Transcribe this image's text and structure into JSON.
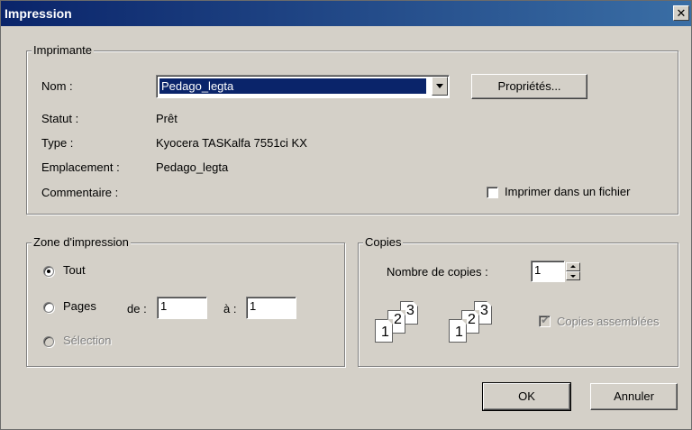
{
  "window": {
    "title": "Impression",
    "close_glyph": "✕"
  },
  "printer": {
    "group_label": "Imprimante",
    "name_label": "Nom :",
    "name_value": "Pedago_legta",
    "properties_button": "Propriétés...",
    "status_label": "Statut :",
    "status_value": "Prêt",
    "type_label": "Type :",
    "type_value": "Kyocera TASKalfa 7551ci KX",
    "location_label": "Emplacement :",
    "location_value": "Pedago_legta",
    "comment_label": "Commentaire :",
    "comment_value": "",
    "print_to_file_label": "Imprimer dans un fichier",
    "print_to_file_checked": false
  },
  "print_range": {
    "group_label": "Zone d'impression",
    "all_label": "Tout",
    "all_selected": true,
    "pages_label": "Pages",
    "from_label": "de :",
    "from_value": "1",
    "to_label": "à :",
    "to_value": "1",
    "selection_label": "Sélection"
  },
  "copies": {
    "group_label": "Copies",
    "count_label": "Nombre de copies :",
    "count_value": "1",
    "collate_label": "Copies assemblées",
    "collate_checked": true,
    "collate_pages": [
      "1",
      "2",
      "3"
    ]
  },
  "buttons": {
    "ok": "OK",
    "cancel": "Annuler"
  },
  "colors": {
    "dialog_bg": "#d4d0c8",
    "title_bg": "#0a246a",
    "selection_bg": "#0a246a"
  },
  "icons": [
    "close-icon",
    "dropdown-arrow-icon",
    "spin-up-icon",
    "spin-down-icon",
    "collate-pages-icon"
  ]
}
